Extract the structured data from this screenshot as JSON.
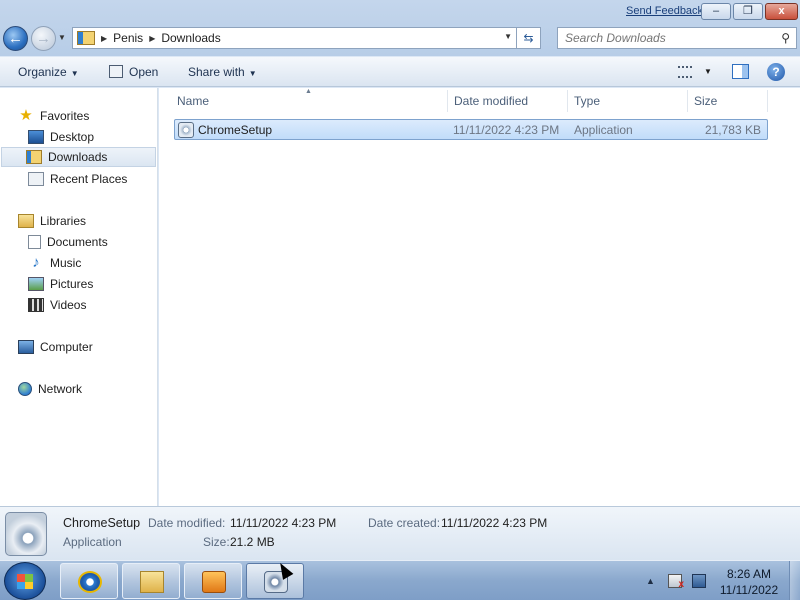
{
  "window": {
    "send_feedback": "Send Feedback",
    "minimize_symbol": "–",
    "maximize_symbol": "❐",
    "close_symbol": "x"
  },
  "address": {
    "crumbs": [
      "Penis",
      "Downloads"
    ],
    "search_placeholder": "Search Downloads"
  },
  "toolbar": {
    "organize": "Organize",
    "open": "Open",
    "share_with": "Share with",
    "help": "?"
  },
  "nav": {
    "favorites": "Favorites",
    "desktop": "Desktop",
    "downloads": "Downloads",
    "recent_places": "Recent Places",
    "libraries": "Libraries",
    "documents": "Documents",
    "music": "Music",
    "pictures": "Pictures",
    "videos": "Videos",
    "computer": "Computer",
    "network": "Network"
  },
  "files": {
    "columns": [
      "Name",
      "Date modified",
      "Type",
      "Size"
    ],
    "rows": [
      {
        "name": "ChromeSetup",
        "date_modified": "11/11/2022 4:23 PM",
        "type": "Application",
        "size": "21,783 KB"
      }
    ]
  },
  "details": {
    "name": "ChromeSetup",
    "type": "Application",
    "date_modified_label": "Date modified:",
    "date_modified": "11/11/2022 4:23 PM",
    "date_created_label": "Date created:",
    "date_created": "11/11/2022 4:23 PM",
    "size_label": "Size:",
    "size": "21.2 MB"
  },
  "taskbar": {
    "time": "8:26 AM",
    "date": "11/11/2022"
  },
  "colors": {
    "selection": "#c1dcfa",
    "taskbar": "#8aa8cd",
    "accent": "#1a3f7a"
  }
}
